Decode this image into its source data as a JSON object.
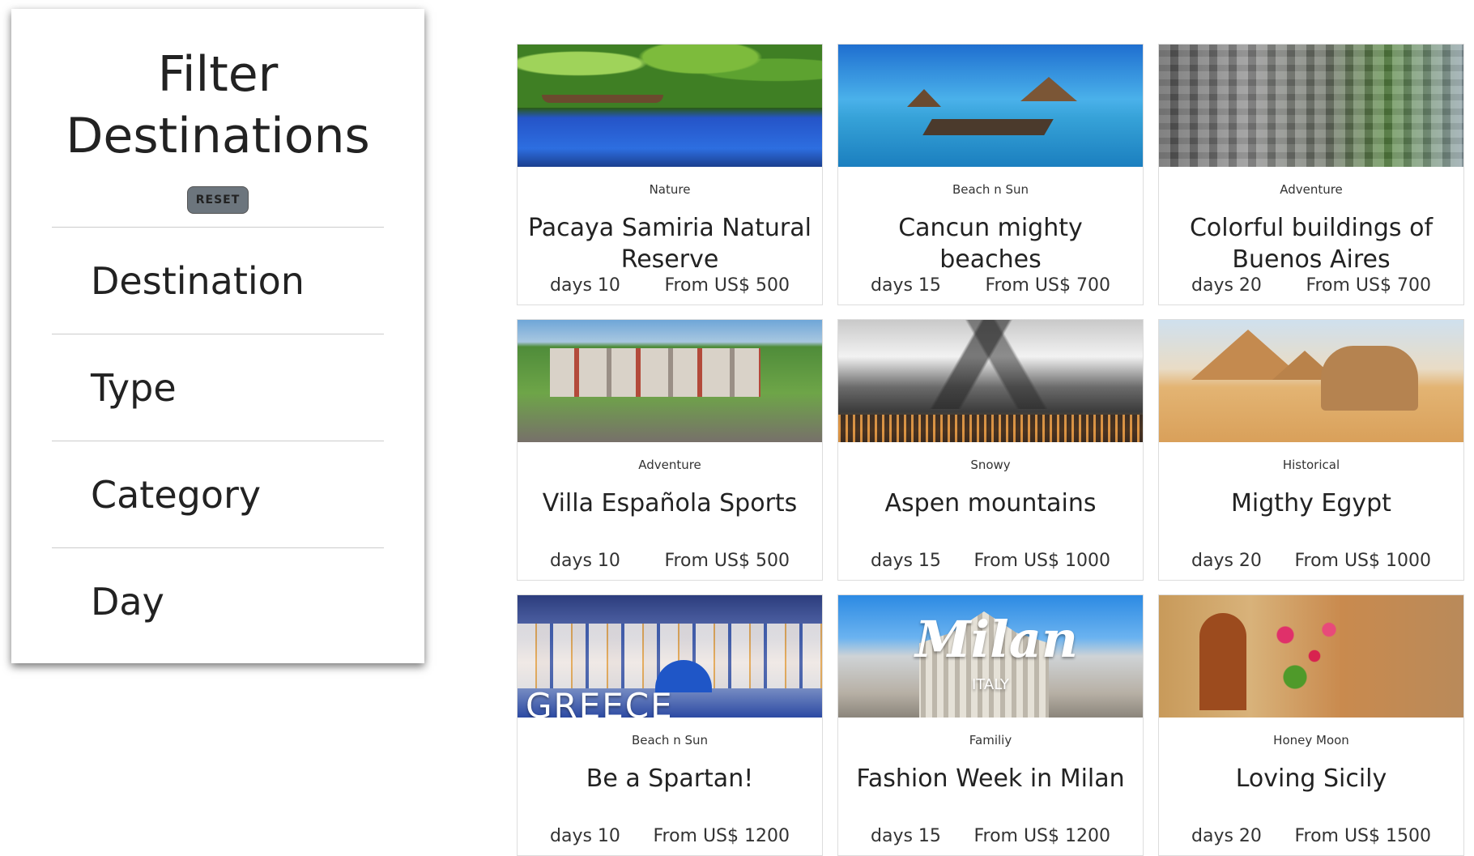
{
  "filter": {
    "title_line1": "Filter",
    "title_line2": "Destinations",
    "reset_label": "RESET",
    "sections": [
      "Destination",
      "Type",
      "Category",
      "Day"
    ]
  },
  "cards": [
    {
      "type": "Nature",
      "title": "Pacaya Samiria Natural Reserve",
      "days": "days 10",
      "price": "From US$ 500",
      "image": "nature-river-image"
    },
    {
      "type": "Beach n Sun",
      "title": "Cancun mighty beaches",
      "days": "days 15",
      "price": "From US$ 700",
      "image": "beach-pier-image"
    },
    {
      "type": "Adventure",
      "title": "Colorful buildings of Buenos Aires",
      "days": "days 20",
      "price": "From US$ 700",
      "image": "city-aerial-image"
    },
    {
      "type": "Adventure",
      "title": "Villa Española Sports",
      "days": "days 10",
      "price": "From US$ 500",
      "image": "villa-aerial-image"
    },
    {
      "type": "Snowy",
      "title": "Aspen mountains",
      "days": "days 15",
      "price": "From US$ 1000",
      "image": "snowy-mountains-image"
    },
    {
      "type": "Historical",
      "title": "Migthy Egypt",
      "days": "days 20",
      "price": "From US$ 1000",
      "image": "pyramids-sphinx-image"
    },
    {
      "type": "Beach n Sun",
      "title": "Be a Spartan!",
      "days": "days 10",
      "price": "From US$ 1200",
      "image": "greece-island-image",
      "overlay": "GREECE"
    },
    {
      "type": "Familiy",
      "title": "Fashion Week in Milan",
      "days": "days 15",
      "price": "From US$ 1200",
      "image": "milan-cathedral-image",
      "overlay": "Milan",
      "overlay_sub": "ITALY"
    },
    {
      "type": "Honey Moon",
      "title": "Loving Sicily",
      "days": "days 20",
      "price": "From US$ 1500",
      "image": "sicily-street-image"
    }
  ]
}
